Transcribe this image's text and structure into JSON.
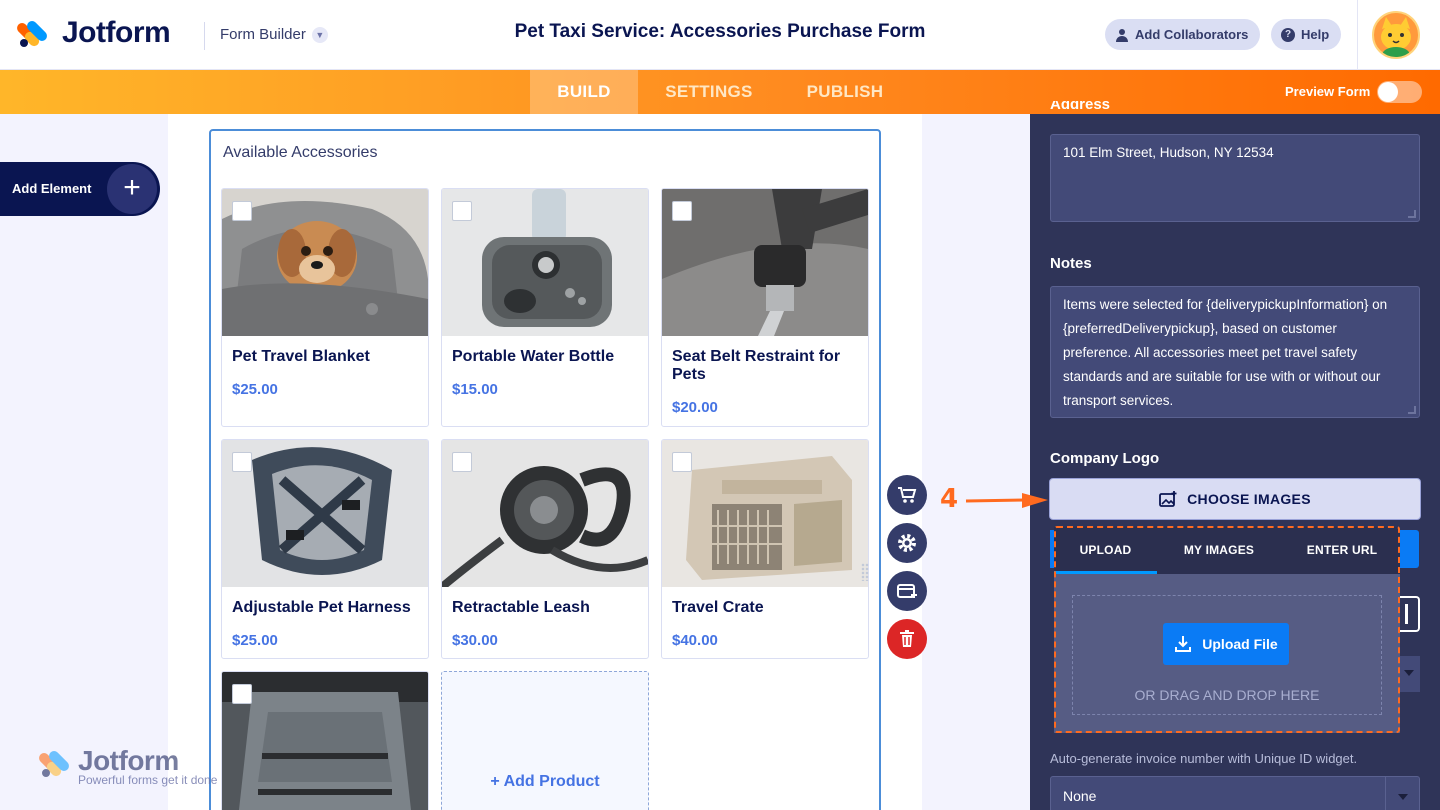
{
  "header": {
    "logo_text": "Jotform",
    "mode_label": "Form Builder",
    "form_title": "Pet Taxi Service: Accessories Purchase Form",
    "collaborators_label": "Add Collaborators",
    "help_label": "Help"
  },
  "nav": {
    "tabs": [
      {
        "label": "BUILD",
        "active": true
      },
      {
        "label": "SETTINGS",
        "active": false
      },
      {
        "label": "PUBLISH",
        "active": false
      }
    ],
    "preview_label": "Preview Form",
    "preview_enabled": false
  },
  "left": {
    "add_element_label": "Add Element",
    "add_element_icon": "plus-icon"
  },
  "widget": {
    "title": "Available Accessories",
    "products": [
      {
        "name": "Pet Travel Blanket",
        "price": "$25.00"
      },
      {
        "name": "Portable Water Bottle",
        "price": "$15.00"
      },
      {
        "name": "Seat Belt Restraint for Pets",
        "price": "$20.00"
      },
      {
        "name": "Adjustable Pet Harness",
        "price": "$25.00"
      },
      {
        "name": "Retractable Leash",
        "price": "$30.00"
      },
      {
        "name": "Travel Crate",
        "price": "$40.00"
      },
      {
        "name": "",
        "price": ""
      }
    ],
    "add_product_label": "+ Add Product"
  },
  "tools": [
    "cart-icon",
    "gear-icon",
    "payment-card-icon",
    "trash-icon"
  ],
  "watermark": {
    "text": "Jotform",
    "tagline": "Powerful forms get it done"
  },
  "panel": {
    "address_label": "Address",
    "address_value": "101 Elm Street, Hudson, NY 12534",
    "notes_label": "Notes",
    "notes_value": "Items were selected for {deliverypickupInformation} on {preferredDeliverypickup}, based on customer preference. All accessories meet pet travel safety standards and are suitable for use with or without our transport services.",
    "logo_label": "Company Logo",
    "choose_images_label": "CHOOSE IMAGES",
    "upload_tabs": [
      {
        "label": "UPLOAD",
        "active": true
      },
      {
        "label": "MY IMAGES",
        "active": false
      },
      {
        "label": "ENTER URL",
        "active": false
      }
    ],
    "upload_button_label": "Upload File",
    "drag_drop_text": "OR DRAG AND DROP HERE",
    "invoice_hint": "Auto-generate invoice number with Unique ID widget.",
    "invoice_select_value": "None"
  },
  "annotation": {
    "step": "4",
    "color": "#ff6a1f"
  },
  "colors": {
    "navy": "#0a1551",
    "orange_start": "#ffb629",
    "orange_end": "#ff6a00",
    "panel_bg": "#2f3458",
    "link_blue": "#4573e3",
    "upload_blue": "#0a7bf5"
  }
}
